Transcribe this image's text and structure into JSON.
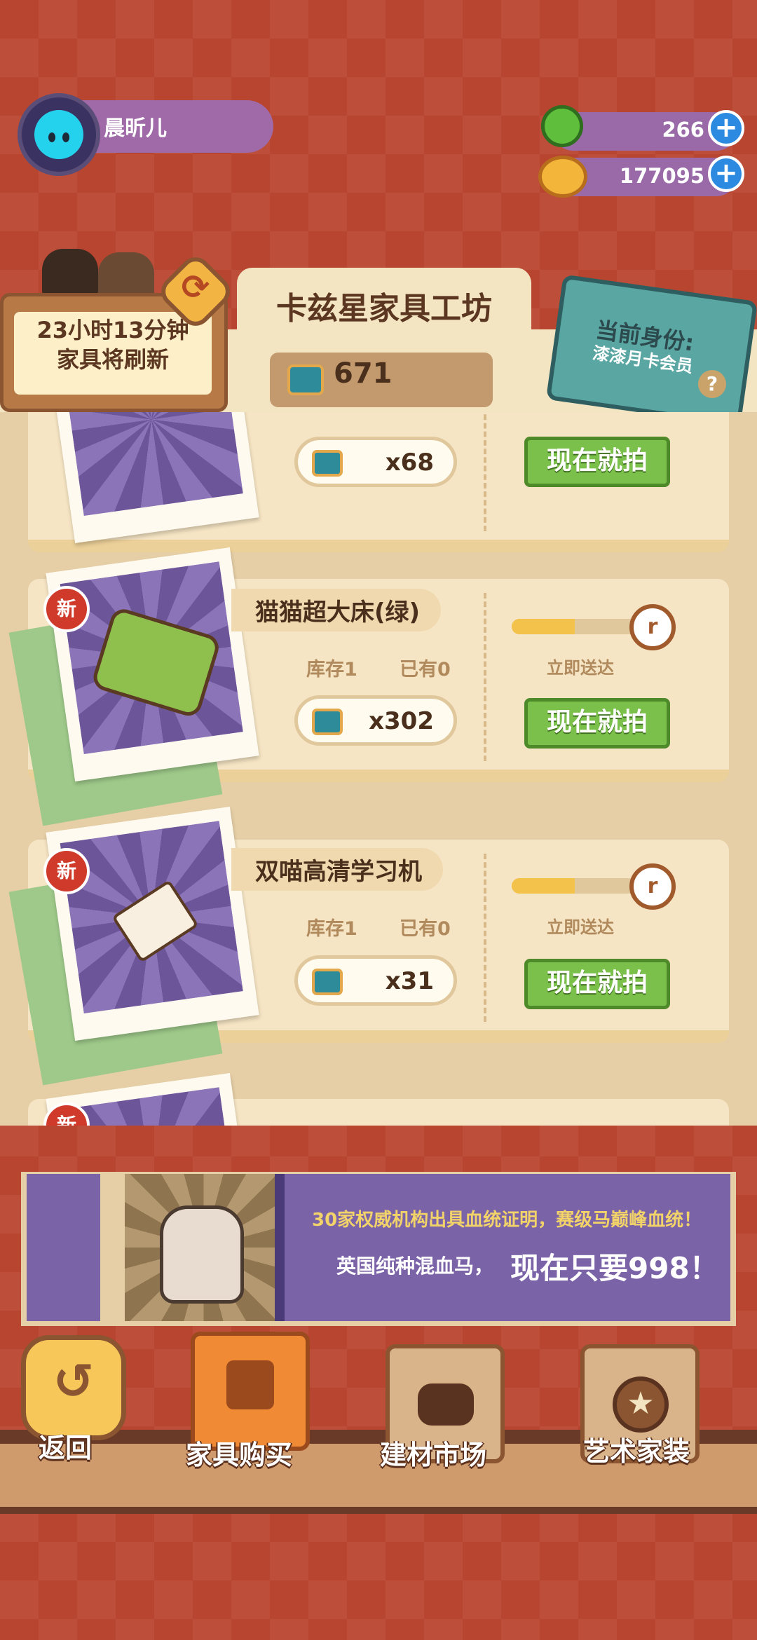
{
  "profile": {
    "username": "晨昕儿"
  },
  "currency": {
    "gems": "266",
    "coins": "177095",
    "plus": "+"
  },
  "shop": {
    "title": "卡兹星家具工坊",
    "ticket_count": "671",
    "refresh_timer_line1": "23小时13分钟",
    "refresh_timer_line2": "家具将刷新",
    "refresh_glyph": "⟳",
    "membership_title": "当前身份:",
    "membership_value": "漆漆月卡会员",
    "help": "?"
  },
  "items": [
    {
      "price": "x68",
      "buy_label": "现在就拍"
    },
    {
      "new_badge": "新",
      "name": "猫猫超大床(绿)",
      "stock_label": "库存1",
      "owned_label": "已有0",
      "deliver_label": "立即送达",
      "progress": 0.45,
      "price": "x302",
      "buy_label": "现在就拍"
    },
    {
      "new_badge": "新",
      "name": "双喵高清学习机",
      "stock_label": "库存1",
      "owned_label": "已有0",
      "deliver_label": "立即送达",
      "progress": 0.45,
      "price": "x31",
      "buy_label": "现在就拍"
    },
    {
      "new_badge": "新"
    }
  ],
  "banner": {
    "line1": "30家权威机构出具血统证明，赛级马巅峰血统！",
    "line2a": "英国纯种混血马，",
    "line2b": "现在只要998！"
  },
  "nav": {
    "back": "返回",
    "furniture": "家具购买",
    "materials": "建材市场",
    "art": "艺术家装"
  }
}
